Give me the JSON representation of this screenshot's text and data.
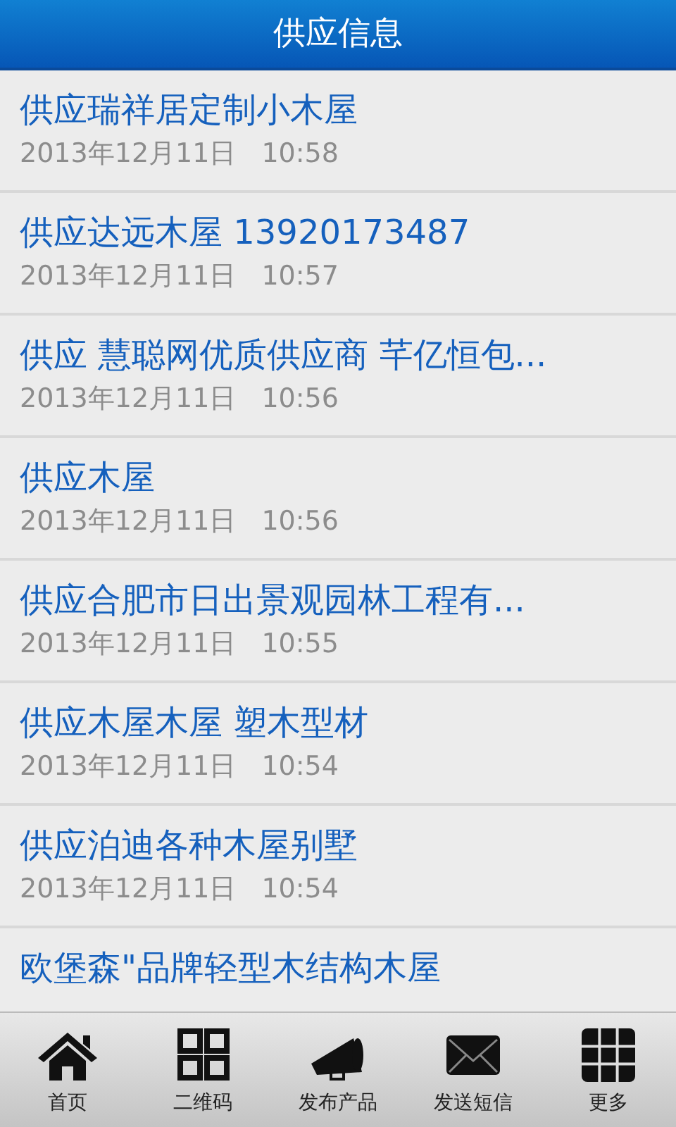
{
  "header": {
    "title": "供应信息"
  },
  "items": [
    {
      "title": "供应瑞祥居定制小木屋",
      "date": "2013年12月11日",
      "time": "10:58"
    },
    {
      "title": "供应达远木屋 13920173487",
      "date": "2013年12月11日",
      "time": "10:57"
    },
    {
      "title": "供应 慧聪网优质供应商 芊亿恒包...",
      "date": "2013年12月11日",
      "time": "10:56"
    },
    {
      "title": "供应木屋",
      "date": "2013年12月11日",
      "time": "10:56"
    },
    {
      "title": "供应合肥市日出景观园林工程有...",
      "date": "2013年12月11日",
      "time": "10:55"
    },
    {
      "title": "供应木屋木屋 塑木型材",
      "date": "2013年12月11日",
      "time": "10:54"
    },
    {
      "title": "供应泊迪各种木屋别墅",
      "date": "2013年12月11日",
      "time": "10:54"
    },
    {
      "title": "欧堡森\"品牌轻型木结构木屋"
    }
  ],
  "tabbar": [
    {
      "kind": "home",
      "label": "首页"
    },
    {
      "kind": "qrcode",
      "label": "二维码"
    },
    {
      "kind": "megaphone",
      "label": "发布产品"
    },
    {
      "kind": "mail",
      "label": "发送短信"
    },
    {
      "kind": "grid",
      "label": "更多"
    }
  ]
}
